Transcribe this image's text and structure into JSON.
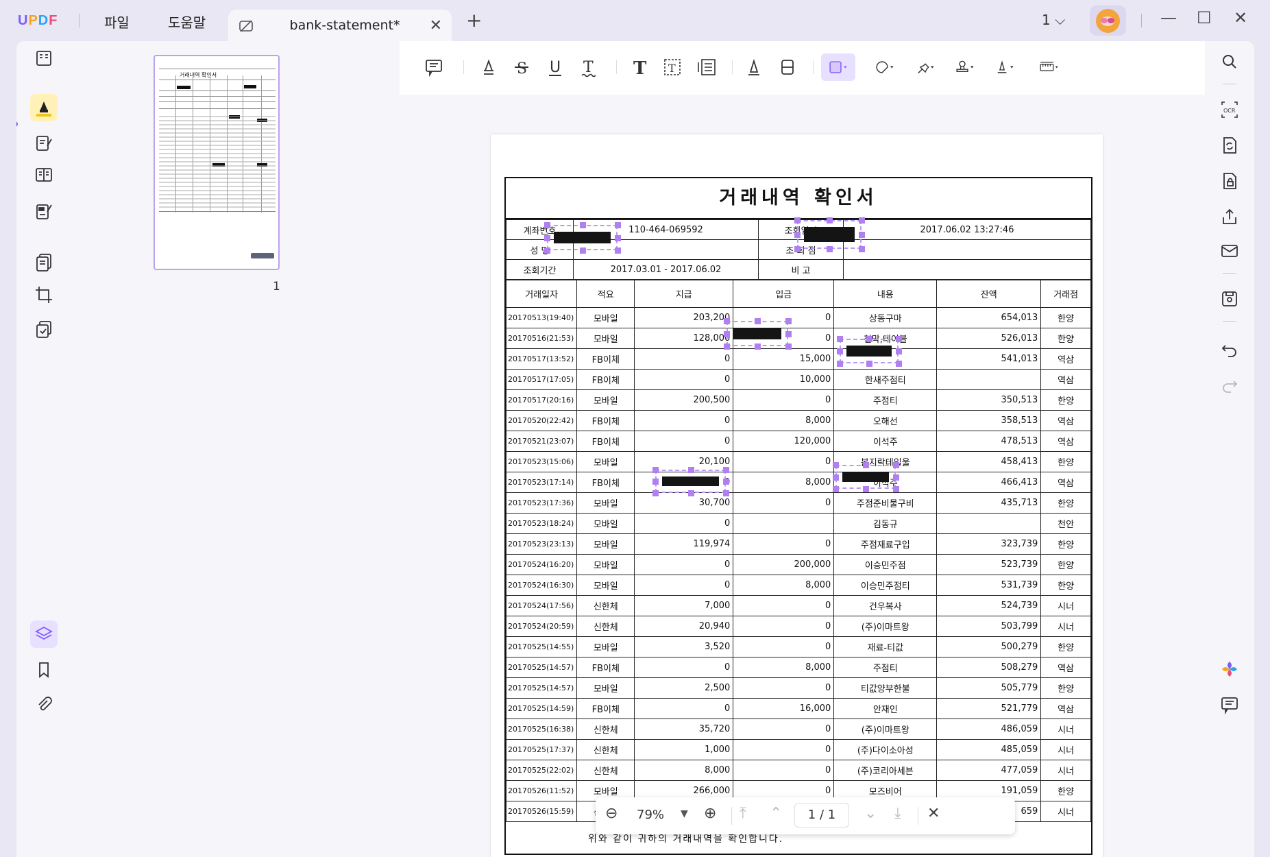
{
  "app": {
    "logo": "UPDF",
    "menu": [
      "파일",
      "도움말"
    ]
  },
  "tab": {
    "title": "bank-statement*"
  },
  "window": {
    "page_selector": "1"
  },
  "thumbnails": {
    "title": "거래내역 확인서",
    "page_number": "1"
  },
  "document": {
    "title": "거래내역 확인서",
    "account_label": "계좌번호",
    "account_value": "110-464-069592",
    "inquiry_time_label": "조회일시",
    "inquiry_time_value": "2017.06.02 13:27:46",
    "name_label": "성 명",
    "branch_label": "조 회 점",
    "period_label": "조회기간",
    "period_value": "2017.03.01 - 2017.06.02",
    "remark_label": "비 고",
    "columns": [
      "거래일자",
      "적요",
      "지급",
      "입금",
      "내용",
      "잔액",
      "거래점"
    ],
    "rows": [
      [
        "20170513(19:40)",
        "모바일",
        "203,200",
        "0",
        "상동구마",
        "654,013",
        "한양"
      ],
      [
        "20170516(21:53)",
        "모바일",
        "128,000",
        "0",
        "천막,테이블",
        "526,013",
        "한양"
      ],
      [
        "20170517(13:52)",
        "FB이체",
        "0",
        "15,000",
        "",
        "541,013",
        "역삼"
      ],
      [
        "20170517(17:05)",
        "FB이체",
        "0",
        "10,000",
        "한새주점티",
        "",
        "역삼"
      ],
      [
        "20170517(20:16)",
        "모바일",
        "200,500",
        "0",
        "주점티",
        "350,513",
        "한양"
      ],
      [
        "20170520(22:42)",
        "FB이체",
        "0",
        "8,000",
        "오해선",
        "358,513",
        "역삼"
      ],
      [
        "20170521(23:07)",
        "FB이체",
        "0",
        "120,000",
        "이석주",
        "478,513",
        "역삼"
      ],
      [
        "20170523(15:06)",
        "모바일",
        "20,100",
        "0",
        "봄지락테일울",
        "458,413",
        "한양"
      ],
      [
        "20170523(17:14)",
        "FB이체",
        "0",
        "8,000",
        "이석주",
        "466,413",
        "역삼"
      ],
      [
        "20170523(17:36)",
        "모바일",
        "30,700",
        "0",
        "주점준비물구비",
        "435,713",
        "한양"
      ],
      [
        "20170523(18:24)",
        "모바일",
        "0",
        "",
        "김동규",
        "",
        "천안"
      ],
      [
        "20170523(23:13)",
        "모바일",
        "119,974",
        "0",
        "주점재료구입",
        "323,739",
        "한양"
      ],
      [
        "20170524(16:20)",
        "모바일",
        "0",
        "200,000",
        "이승민주점",
        "523,739",
        "한양"
      ],
      [
        "20170524(16:30)",
        "모바일",
        "0",
        "8,000",
        "이승민주점티",
        "531,739",
        "한양"
      ],
      [
        "20170524(17:56)",
        "신한체",
        "7,000",
        "0",
        "건우복사",
        "524,739",
        "시너"
      ],
      [
        "20170524(20:59)",
        "신한체",
        "20,940",
        "0",
        "(주)이마트왕",
        "503,799",
        "시너"
      ],
      [
        "20170525(14:55)",
        "모바일",
        "3,520",
        "0",
        "재료-티값",
        "500,279",
        "한양"
      ],
      [
        "20170525(14:57)",
        "FB이체",
        "0",
        "8,000",
        "주점티",
        "508,279",
        "역삼"
      ],
      [
        "20170525(14:57)",
        "모바일",
        "2,500",
        "0",
        "티값양부한불",
        "505,779",
        "한양"
      ],
      [
        "20170525(14:59)",
        "FB이체",
        "0",
        "16,000",
        "안재인",
        "521,779",
        "역삼"
      ],
      [
        "20170525(16:38)",
        "신한체",
        "35,720",
        "0",
        "(주)이마트왕",
        "486,059",
        "시너"
      ],
      [
        "20170525(17:37)",
        "신한체",
        "1,000",
        "0",
        "(주)다이소아성",
        "485,059",
        "시너"
      ],
      [
        "20170525(22:02)",
        "신한체",
        "8,000",
        "0",
        "(주)코리아세븐",
        "477,059",
        "시너"
      ],
      [
        "20170526(11:52)",
        "모바일",
        "266,000",
        "0",
        "모즈비어",
        "191,059",
        "한양"
      ],
      [
        "20170526(15:59)",
        "신한체",
        "",
        "",
        "",
        "659",
        "시너"
      ]
    ],
    "footer": "위와 같이 귀하의 거래내역을 확인합니다."
  },
  "zoom": {
    "level": "79%",
    "current_page": "1",
    "total_pages": "1",
    "page_separator": "/"
  },
  "colors": {
    "accent": "#7b5cff",
    "highlight_active": "#fff1b8",
    "annotation": "#b07ff0"
  }
}
